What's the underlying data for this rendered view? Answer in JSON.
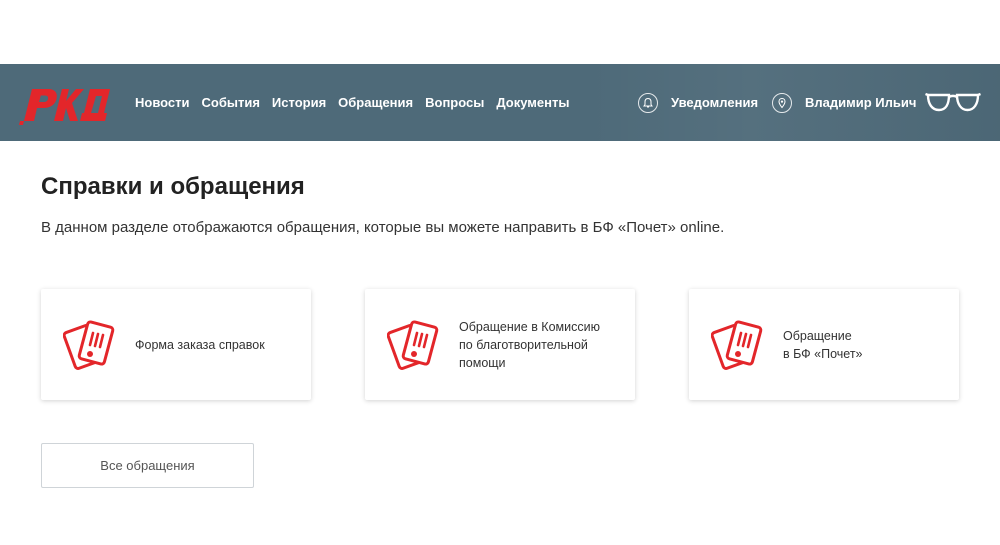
{
  "header": {
    "logo_text": "РЖД",
    "nav": [
      {
        "label": "Новости"
      },
      {
        "label": "События"
      },
      {
        "label": "История"
      },
      {
        "label": "Обращения"
      },
      {
        "label": "Вопросы"
      },
      {
        "label": "Документы"
      }
    ],
    "notifications_label": "Уведомления",
    "user_name": "Владимир Ильич",
    "icons": {
      "notifications": "bell-icon",
      "user": "location-pin-icon",
      "accessibility": "glasses-icon"
    }
  },
  "main": {
    "title": "Справки и обращения",
    "subtitle": "В данном разделе отображаются обращения, которые вы можете направить в БФ «Почет» online.",
    "cards": [
      {
        "lines": [
          "Форма заказа справок"
        ],
        "icon": "cards-icon"
      },
      {
        "lines": [
          "Обращение в Комиссию",
          "по благотворительной",
          "помощи"
        ],
        "icon": "cards-icon"
      },
      {
        "lines": [
          "Обращение",
          "в БФ «Почет»"
        ],
        "icon": "cards-icon"
      }
    ],
    "all_button_label": "Все обращения"
  },
  "colors": {
    "header_bg": "#4e6a79",
    "brand_red": "#e3262a",
    "text_dark": "#222222"
  }
}
